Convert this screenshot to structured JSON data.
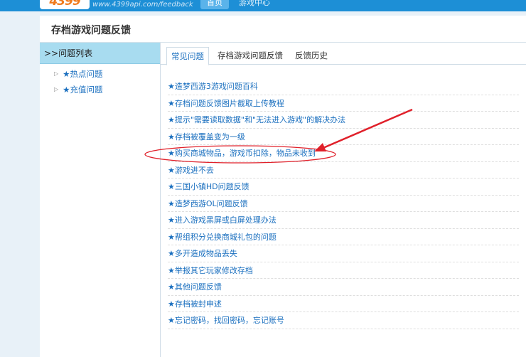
{
  "header": {
    "logo_text": "4399",
    "url_text": "www.4399api.com/feedback",
    "nav_home": "首页",
    "nav_center": "游戏中心"
  },
  "page_title": "存档游戏问题反馈",
  "sidebar": {
    "heading": "问题列表",
    "items": [
      {
        "label": "热点问题"
      },
      {
        "label": "充值问题"
      }
    ]
  },
  "tabs": [
    {
      "label": "常见问题",
      "active": true
    },
    {
      "label": "存档游戏问题反馈",
      "active": false
    },
    {
      "label": "反馈历史",
      "active": false
    }
  ],
  "faq": [
    "造梦西游3游戏问题百科",
    "存档问题反馈图片截取上传教程",
    "提示\"需要读取数据\"和\"无法进入游戏\"的解决办法",
    "存档被覆盖变为一级",
    "购买商城物品，游戏币扣除，物品未收到",
    "游戏进不去",
    "三国小镇HD问题反馈",
    "造梦西游OL问题反馈",
    "进入游戏黑屏或白屏处理办法",
    "帮组积分兑换商城礼包的问题",
    "多开造成物品丢失",
    "举报其它玩家修改存档",
    "其他问题反馈",
    "存档被封申述",
    "忘记密码，找回密码，忘记账号"
  ],
  "highlighted_index": 4,
  "colors": {
    "link": "#1a6fbf",
    "topbar": "#1d8fd6",
    "sidebar_head": "#a8dcf0",
    "annotation": "#e0202a"
  }
}
